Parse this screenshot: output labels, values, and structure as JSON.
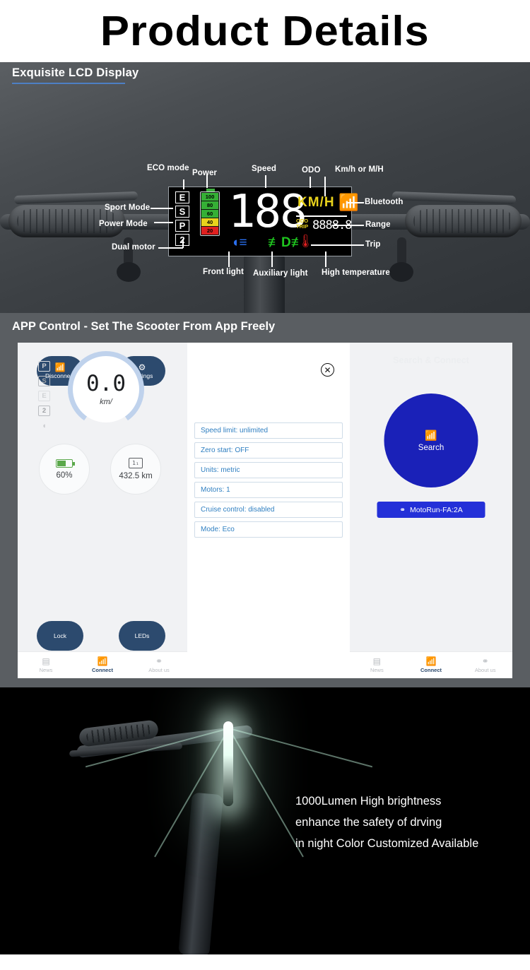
{
  "page": {
    "title": "Product Details"
  },
  "lcd": {
    "heading": "Exquisite LCD Display",
    "callouts": {
      "eco_mode": "ECO mode",
      "power": "Power",
      "speed": "Speed",
      "odo": "ODO",
      "unit_toggle": "Km/h or M/H",
      "sport_mode": "Sport Mode",
      "power_mode": "Power Mode",
      "dual_motor": "Dual motor",
      "bluetooth": "Bluetooth",
      "range": "Range",
      "trip": "Trip",
      "front_light": "Front light",
      "auxiliary_light": "Auxiliary light",
      "high_temperature": "High temperature"
    },
    "screen": {
      "modes": [
        "E",
        "S",
        "P",
        "2"
      ],
      "battery_segments": [
        {
          "label": "100",
          "color": "#35b035"
        },
        {
          "label": "80",
          "color": "#35b035"
        },
        {
          "label": "60",
          "color": "#35b035"
        },
        {
          "label": "40",
          "color": "#e8d21c"
        },
        {
          "label": "20",
          "color": "#e02020"
        }
      ],
      "speed_value": "188",
      "unit": "KM/H",
      "bluetooth_icon": "bluetooth-icon",
      "odo_label": "ODO",
      "trip_label": "TRIP",
      "odo_value": "8888.8",
      "front_light_icon": "headlight-icon",
      "aux_light_icon": "auxiliary-light-icon",
      "temp_icon": "thermometer-icon"
    }
  },
  "app": {
    "heading": "APP Control - Set The Scooter From App Freely",
    "left": {
      "disconnect": {
        "label": "Disconnect",
        "icon": "bluetooth-off-icon"
      },
      "settings": {
        "label": "Settings",
        "icon": "gear-icon"
      },
      "modes": [
        "P",
        "S",
        "E",
        "2"
      ],
      "lamp_icon": "lamp-icon",
      "speed_value": "0.0",
      "speed_unit": "km/",
      "battery": {
        "value": "60%",
        "icon": "battery-icon"
      },
      "odometer": {
        "value": "432.5 km",
        "icon": "odometer-icon"
      },
      "lock": "Lock",
      "leds": "LEDs"
    },
    "settings_list": [
      "Speed limit: unlimited",
      "Zero start: OFF",
      "Units: metric",
      "Motors: 1",
      "Cruise control: disabled",
      "Mode: Eco"
    ],
    "close_icon": "close-circle-icon",
    "right": {
      "heading": "Search & Connect",
      "search_label": "Search",
      "search_icon": "bluetooth-icon",
      "device_name": "MotoRun-FA:2A",
      "device_icon": "scooter-icon"
    },
    "nav": [
      {
        "label": "News",
        "icon": "news-icon",
        "active": false
      },
      {
        "label": "Connect",
        "icon": "bluetooth-icon",
        "active": true
      },
      {
        "label": "About us",
        "icon": "scooter-icon",
        "active": false
      }
    ]
  },
  "light": {
    "line1": "1000Lumen High brightness",
    "line2": "enhance the safety of drving",
    "line3": "in night Color Customized Available"
  },
  "colors": {
    "accent_blue": "#4d7fc4",
    "app_navy": "#2c4a6e",
    "app_blue": "#1a21b8",
    "list_blue": "#2f7fc1"
  }
}
